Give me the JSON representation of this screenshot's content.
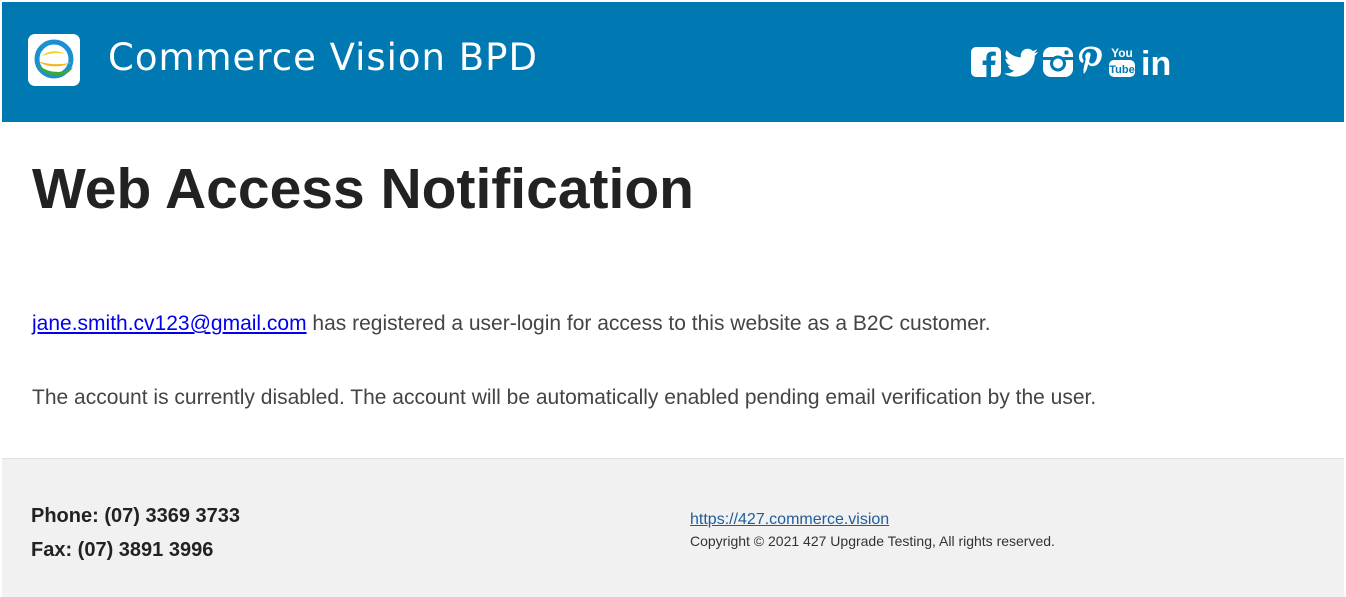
{
  "header": {
    "brand": "Commerce Vision BPD",
    "background_color": "#0079b3",
    "logo_icon": "commerce-vision-logo",
    "social_icons": [
      "facebook-icon",
      "twitter-icon",
      "instagram-icon",
      "pinterest-icon",
      "youtube-icon",
      "linkedin-icon"
    ],
    "youtube_label_top": "You",
    "youtube_label_bottom": "Tube",
    "linkedin_label": "in"
  },
  "main": {
    "title": "Web Access Notification",
    "registration": {
      "email": "jane.smith.cv123@gmail.com",
      "text": " has registered a user-login for access to this website as a B2C customer."
    },
    "status_text": "The account is currently disabled. The account will be automatically enabled pending email verification by the user."
  },
  "footer": {
    "phone": "Phone: (07) 3369 3733",
    "fax": "Fax: (07) 3891 3996",
    "website": "https://427.commerce.vision",
    "copyright": "Copyright © 2021 427 Upgrade Testing, All rights reserved.",
    "background_color": "#f1f1f1"
  }
}
